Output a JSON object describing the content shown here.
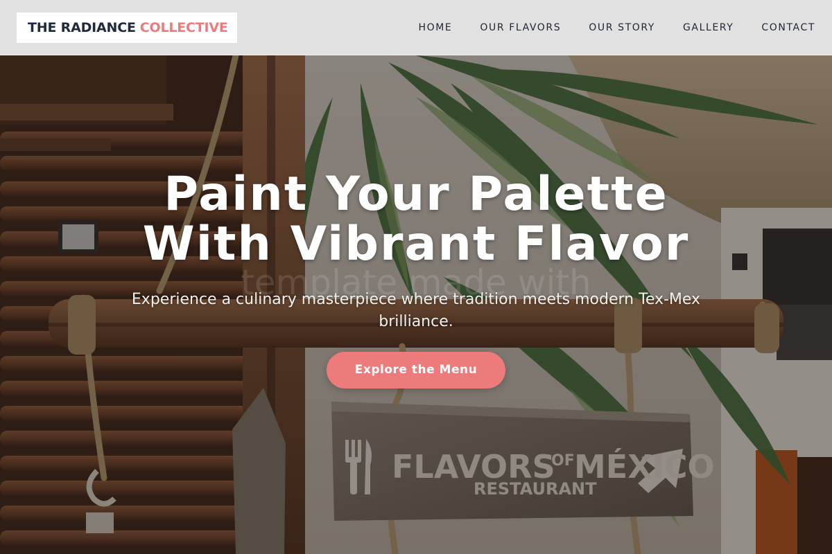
{
  "brand": {
    "name_primary": "THE RADIANCE",
    "name_accent": "COLLECTIVE",
    "accent_color": "#ee7b7b",
    "primary_color": "#1f2a3d"
  },
  "nav": {
    "items": [
      {
        "label": "HOME"
      },
      {
        "label": "OUR FLAVORS"
      },
      {
        "label": "OUR STORY"
      },
      {
        "label": "GALLERY"
      },
      {
        "label": "CONTACT"
      }
    ]
  },
  "hero": {
    "title": "Paint Your Palette With Vibrant Flavor",
    "subtitle": "Experience a culinary masterpiece where tradition meets modern Tex-Mex brilliance.",
    "cta_label": "Explore the Menu",
    "watermark": "template made with"
  },
  "background_sign": {
    "title": "FLAVORS OF MÉXICO",
    "title_main": "FLAVORS",
    "title_of": "OF",
    "title_country": "MÉXICO",
    "subtitle": "RESTAURANT"
  }
}
